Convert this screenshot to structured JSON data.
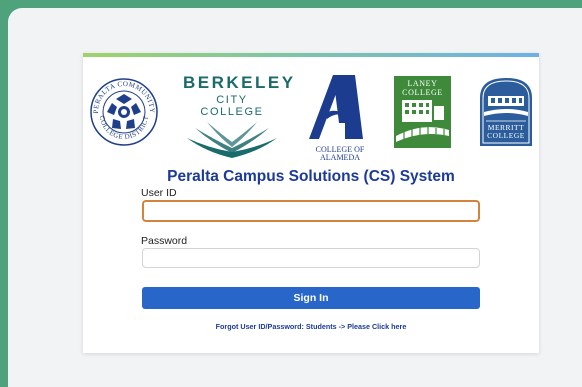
{
  "logos": {
    "peralta": {
      "ring_text": "PERALTA COMMUNITY COLLEGE DISTRICT",
      "icon": "peralta-seal-icon"
    },
    "berkeley": {
      "line1": "BERKELEY",
      "line2": "CITY COLLEGE",
      "icon": "open-book-icon"
    },
    "alameda": {
      "line1": "COLLEGE OF",
      "line2": "ALAMEDA",
      "icon": "letter-a-icon"
    },
    "laney": {
      "line1": "LANEY",
      "line2": "COLLEGE",
      "icon": "laney-building-icon"
    },
    "merritt": {
      "line1": "MERRITT",
      "line2": "COLLEGE",
      "icon": "merritt-seal-icon"
    }
  },
  "title": "Peralta Campus Solutions (CS) System",
  "user_id": {
    "label": "User ID",
    "value": "",
    "placeholder": ""
  },
  "password": {
    "label": "Password",
    "value": "",
    "placeholder": ""
  },
  "sign_in_label": "Sign In",
  "forgot_text": "Forgot User ID/Password: Students -> Please Click here",
  "colors": {
    "background": "#4fa37c",
    "title": "#1b3a9a",
    "button": "#2867c9",
    "focus_border": "#d2843c",
    "berkeley": "#1b6a6c",
    "alameda": "#1c3d8f",
    "laney": "#3e8a3a",
    "merritt": "#2b5d9c"
  }
}
